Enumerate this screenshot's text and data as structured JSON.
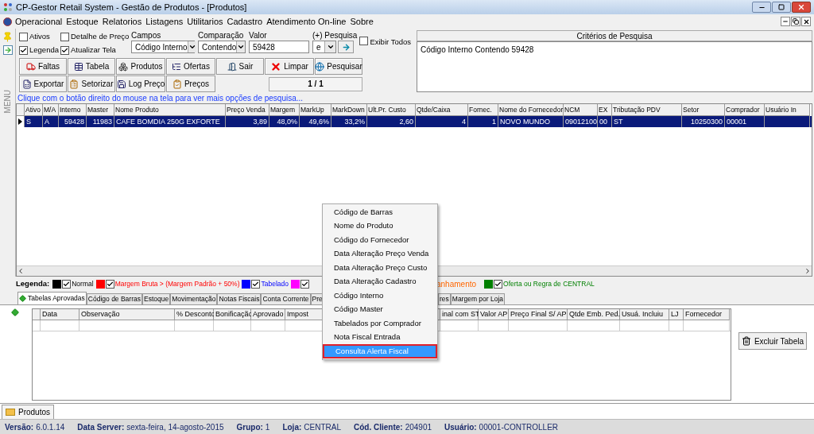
{
  "window": {
    "title": "CP-Gestor Retail System - Gestão de Produtos - [Produtos]"
  },
  "menu": [
    "Operacional",
    "Estoque",
    "Relatorios",
    "Listagens",
    "Utilitarios",
    "Cadastro",
    "Atendimento On-line",
    "Sobre"
  ],
  "side_label": "MENU",
  "options": [
    {
      "label": "Ativos",
      "checked": false
    },
    {
      "label": "Detalhe de Preço",
      "checked": false
    },
    {
      "label": "Legenda",
      "checked": true
    },
    {
      "label": "Atualizar Tela",
      "checked": true
    }
  ],
  "search": {
    "campos": {
      "label": "Campos",
      "value": "Código Interno"
    },
    "comparacao": {
      "label": "Comparação",
      "value": "Contendo"
    },
    "valor": {
      "label": "Valor",
      "value": "59428"
    },
    "pesquisa": {
      "label": "(+) Pesquisa",
      "value": "e"
    },
    "exibir_todos": {
      "label": "Exibir Todos",
      "checked": false
    }
  },
  "buttons": [
    [
      "Faltas",
      "Tabela",
      "Produtos",
      "Ofertas",
      "Sair",
      "Limpar",
      "Pesquisar"
    ],
    [
      "Exportar",
      "Setorizar",
      "Log Preço",
      "Preços"
    ]
  ],
  "page_indicator": "1 / 1",
  "criteria": {
    "title": "Critérios de Pesquisa",
    "text": "Código Interno Contendo 59428"
  },
  "hint": "Clique com o botão direito do mouse na tela para ver mais opções de pesquisa...",
  "table": {
    "columns": [
      "Ativo",
      "M/A",
      "Interno",
      "Master",
      "Nome Produto",
      "Preço Venda",
      "Margem",
      "MarkUp",
      "MarkDown",
      "Ult.Pr. Custo",
      "Qtde/Caixa",
      "Fornec.",
      "Nome do Fornecedor",
      "NCM",
      "EX",
      "Tributação PDV",
      "Setor",
      "Comprador",
      "Usuário In"
    ],
    "rows": [
      {
        "selected": true,
        "cells": [
          "S",
          "A",
          "59428",
          "11983",
          "CAFE BOMDIA 250G EXFORTE",
          "3,89",
          "48,0%",
          "49,6%",
          "33,2%",
          "2,60",
          "4",
          "1",
          "NOVO MUNDO",
          "09012100",
          "00",
          "ST",
          "10250300",
          "00001"
        ]
      }
    ]
  },
  "legend": {
    "title": "Legenda:",
    "items": [
      {
        "kind": "swatch",
        "color": "#000000",
        "checked": true,
        "label": "Normal"
      },
      {
        "kind": "swatch",
        "color": "#ff0000",
        "checked": true,
        "label": "Margem Bruta > (Margem Padrão + 50%)"
      },
      {
        "kind": "swatch",
        "color": "#0000ff",
        "checked": true,
        "label": "Tabelado"
      },
      {
        "kind": "swatch",
        "color": "#ff00ff",
        "checked": true
      },
      {
        "kind": "text",
        "color": "#ff6600",
        "label": "anhamento"
      },
      {
        "kind": "swatch",
        "color": "#008000",
        "checked": true,
        "label": "Oferta ou Regra de CENTRAL"
      }
    ]
  },
  "tabs": [
    {
      "label": "Tabelas Aprovadas",
      "selected": true
    },
    {
      "label": "Código de Barras",
      "selected": false
    },
    {
      "label": "Estoque",
      "selected": false
    },
    {
      "label": "Movimentação",
      "selected": false
    },
    {
      "label": "Notas Fiscais",
      "selected": false
    },
    {
      "label": "Conta Corrente",
      "selected": false
    },
    {
      "label": "Pre",
      "selected": false
    },
    {
      "label": "res",
      "selected": false
    },
    {
      "label": "Margem por Loja",
      "selected": false
    }
  ],
  "grid": {
    "columns": [
      "Data",
      "Observação",
      "% Desconto",
      "Bonificação",
      "Aprovado",
      "Impost",
      "inal com ST",
      "Valor AP",
      "Preço Final S/ AP",
      "Qtde Emb. Ped.",
      "Usuá. Incluiu",
      "LJ",
      "Fornecedor"
    ]
  },
  "delete_button": "Excluir Tabela",
  "context_menu": [
    {
      "label": "Código de Barras",
      "selected": false
    },
    {
      "label": "Nome do Produto",
      "selected": false
    },
    {
      "label": "Código do Fornecedor",
      "selected": false
    },
    {
      "label": "Data Alteração Preço Venda",
      "selected": false
    },
    {
      "label": "Data Alteração Preço Custo",
      "selected": false
    },
    {
      "label": "Data Alteração Cadastro",
      "selected": false
    },
    {
      "label": "Código Interno",
      "selected": false
    },
    {
      "label": "Código Master",
      "selected": false
    },
    {
      "label": "Tabelados por Comprador",
      "selected": false
    },
    {
      "label": "Nota Fiscal Entrada",
      "selected": false
    },
    {
      "label": "Consulta Alerta Fiscal",
      "selected": true
    }
  ],
  "doc_tab": "Produtos",
  "status": [
    {
      "label": "Versão:",
      "value": "6.0.1.14"
    },
    {
      "label": "Data Server:",
      "value": "sexta-feira, 14-agosto-2015"
    },
    {
      "label": "Grupo:",
      "value": "1"
    },
    {
      "label": "Loja:",
      "value": "CENTRAL"
    },
    {
      "label": "Cód. Cliente:",
      "value": "204901"
    },
    {
      "label": "Usuário:",
      "value": "00001-CONTROLLER"
    }
  ]
}
